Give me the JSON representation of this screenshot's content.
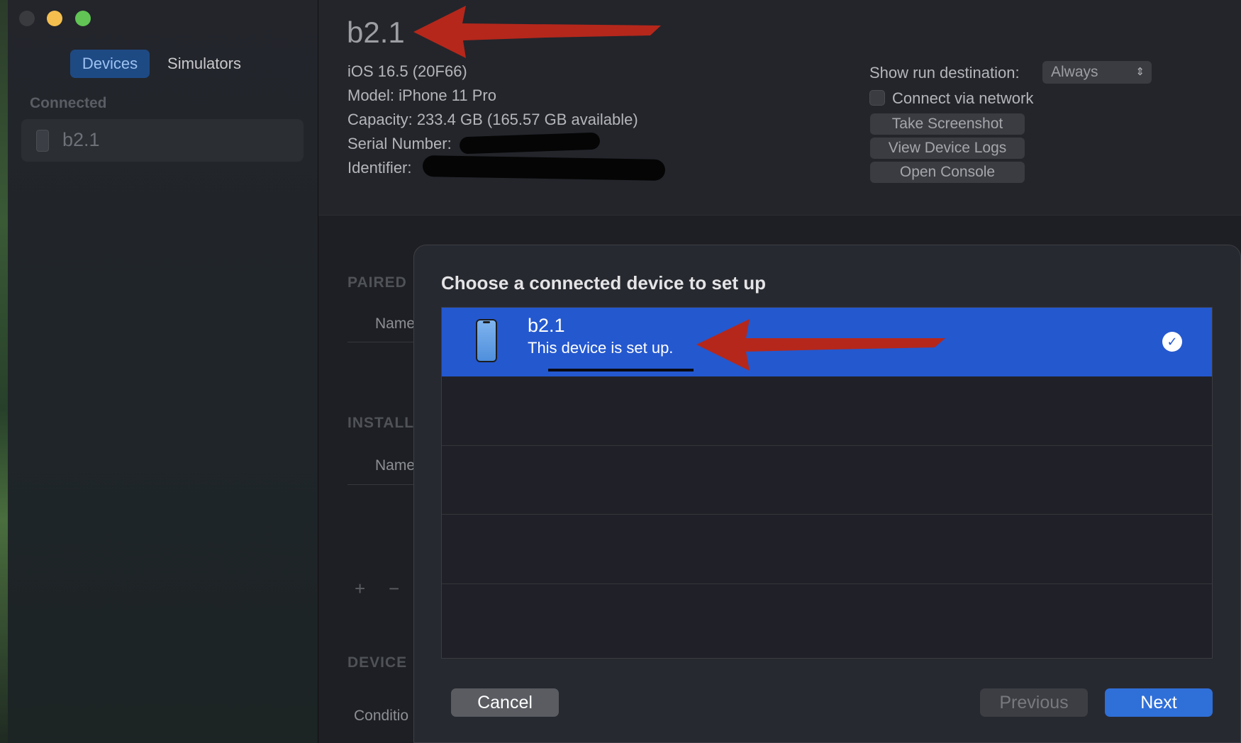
{
  "window": {
    "traffic_lights": [
      "close",
      "minimize",
      "zoom"
    ]
  },
  "sidebar": {
    "tabs": [
      {
        "label": "Devices",
        "selected": true
      },
      {
        "label": "Simulators",
        "selected": false
      }
    ],
    "section_label": "Connected",
    "items": [
      {
        "label": "b2.1",
        "icon": "iphone-icon"
      }
    ]
  },
  "device_info": {
    "title": "b2.1",
    "os": "iOS 16.5 (20F66)",
    "model": "Model: iPhone 11 Pro",
    "capacity": "Capacity: 233.4 GB (165.57 GB available)",
    "serial_label": "Serial Number:",
    "identifier_label": "Identifier:",
    "run_destination_label": "Show run destination:",
    "run_destination_value": "Always",
    "connect_via_network_label": "Connect via network",
    "connect_via_network_checked": false,
    "buttons": {
      "screenshot": "Take Screenshot",
      "logs": "View Device Logs",
      "console": "Open Console"
    }
  },
  "background_sections": {
    "paired": "PAIRED",
    "installed": "INSTALL",
    "device": "DEVICE",
    "name_col": "Name",
    "condition_col": "Conditio",
    "add": "+",
    "remove": "−"
  },
  "dialog": {
    "title": "Choose a connected device to set up",
    "devices": [
      {
        "name": "b2.1",
        "status": "This device is set up.",
        "selected": true,
        "icon": "iphone-icon"
      }
    ],
    "empty_rows": 4,
    "buttons": {
      "cancel": "Cancel",
      "previous": "Previous",
      "next": "Next"
    },
    "check_glyph": "✓"
  },
  "colors": {
    "selection": "#2458cf",
    "primary_button": "#2f6fd8",
    "annotation_arrow": "#b5271b"
  }
}
